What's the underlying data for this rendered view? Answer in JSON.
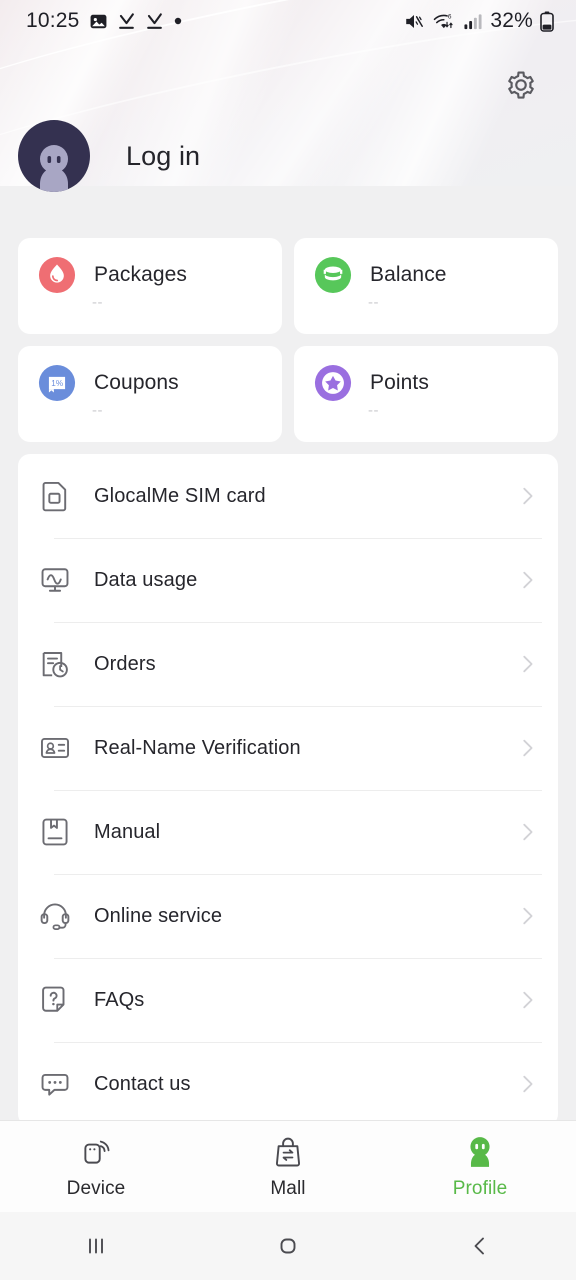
{
  "status_bar": {
    "time": "10:25",
    "battery_percent": "32%",
    "icons": [
      "image-icon",
      "download-icon",
      "download-icon",
      "dot-icon",
      "mute-icon",
      "wifi-6-icon",
      "signal-icon",
      "battery-icon"
    ]
  },
  "header": {
    "settings_icon": "gear-icon",
    "avatar_icon": "default-avatar-icon",
    "login_label": "Log in"
  },
  "stats": [
    {
      "label": "Packages",
      "value": "--",
      "icon": "packages-droplet-icon",
      "color": "#ef6e73"
    },
    {
      "label": "Balance",
      "value": "--",
      "icon": "balance-coins-icon",
      "color": "#57c75a"
    },
    {
      "label": "Coupons",
      "value": "--",
      "icon": "coupon-ticket-icon",
      "color": "#6a8ddb"
    },
    {
      "label": "Points",
      "value": "--",
      "icon": "points-star-icon",
      "color": "#9a6fe0"
    }
  ],
  "menu": [
    {
      "label": "GlocalMe SIM card",
      "icon": "sim-card-icon"
    },
    {
      "label": "Data usage",
      "icon": "data-usage-icon"
    },
    {
      "label": "Orders",
      "icon": "orders-icon"
    },
    {
      "label": "Real-Name Verification",
      "icon": "id-card-icon"
    },
    {
      "label": "Manual",
      "icon": "manual-book-icon"
    },
    {
      "label": "Online service",
      "icon": "headset-icon"
    },
    {
      "label": "FAQs",
      "icon": "faq-icon"
    },
    {
      "label": "Contact us",
      "icon": "chat-bubble-icon"
    }
  ],
  "tabs": [
    {
      "label": "Device",
      "icon": "device-wifi-icon",
      "active": false
    },
    {
      "label": "Mall",
      "icon": "shopping-bag-icon",
      "active": false
    },
    {
      "label": "Profile",
      "icon": "profile-icon",
      "active": true
    }
  ],
  "android_nav": {
    "recents": "recents-icon",
    "home": "home-icon",
    "back": "back-icon"
  },
  "colors": {
    "accent_green": "#58b948",
    "page_bg": "#f0f0f1",
    "card_bg": "#ffffff",
    "avatar_bg": "#343150"
  }
}
